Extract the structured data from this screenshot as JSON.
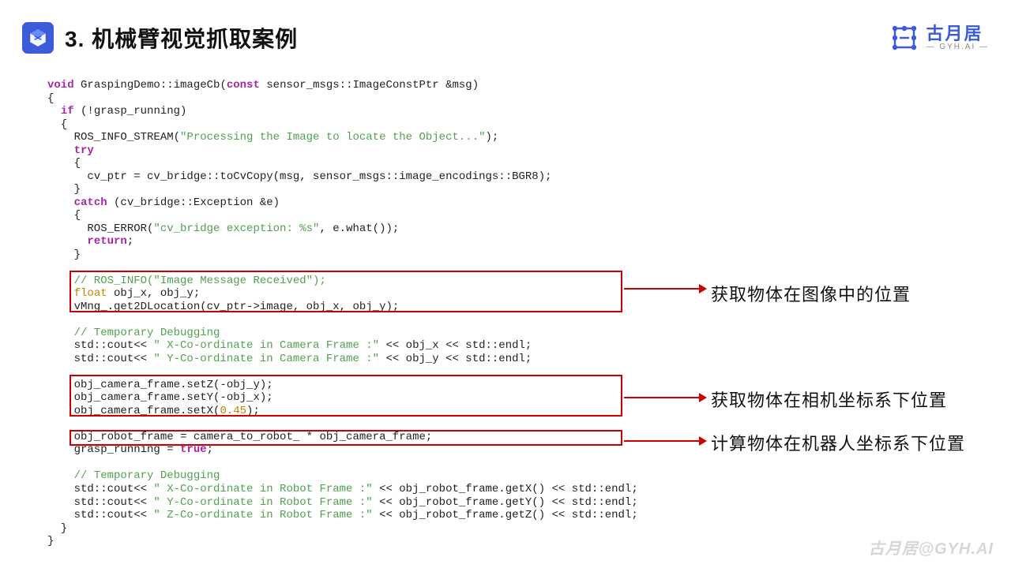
{
  "header": {
    "title": "3. 机械臂视觉抓取案例",
    "brand": {
      "name": "古月居",
      "sub": "— GYH.AI —"
    }
  },
  "code": {
    "fn_sig_pre": "void",
    "fn_sig_name": " GraspingDemo::imageCb(",
    "fn_sig_const": "const",
    "fn_sig_post": " sensor_msgs::ImageConstPtr &msg)",
    "oc1": "{",
    "if_line_pre": "  ",
    "if_kw": "if",
    "if_body": " (!grasp_running)",
    "oc2": "  {",
    "ros_info_pre": "    ROS_INFO_STREAM(",
    "ros_info_str": "\"Processing the Image to locate the Object...\"",
    "ros_info_post": ");",
    "try_pre": "    ",
    "try_kw": "try",
    "oc3": "    {",
    "cvptr": "      cv_ptr = cv_bridge::toCvCopy(msg, sensor_msgs::image_encodings::BGR8);",
    "cc3": "    }",
    "catch_pre": "    ",
    "catch_kw": "catch",
    "catch_body": " (cv_bridge::Exception &e)",
    "oc4": "    {",
    "roserr_pre": "      ROS_ERROR(",
    "roserr_str": "\"cv_bridge exception: %s\"",
    "roserr_post": ", e.what());",
    "return_pre": "      ",
    "return_kw": "return",
    "return_post": ";",
    "cc4": "    }",
    "blank1": "",
    "cmt1": "    // ROS_INFO(\"Image Message Received\");",
    "float_pre": "    ",
    "float_kw": "float",
    "float_post": " obj_x, obj_y;",
    "vmng": "    vMng_.get2DLocation(cv_ptr->image, obj_x, obj_y);",
    "blank2": "",
    "cmt2": "    // Temporary Debugging",
    "cout1_a": "    std::cout<< ",
    "cout1_s": "\" X-Co-ordinate in Camera Frame :\"",
    "cout1_b": " << obj_x << std::endl;",
    "cout2_a": "    std::cout<< ",
    "cout2_s": "\" Y-Co-ordinate in Camera Frame :\"",
    "cout2_b": " << obj_y << std::endl;",
    "blank3": "",
    "setz": "    obj_camera_frame.setZ(-obj_y);",
    "sety": "    obj_camera_frame.setY(-obj_x);",
    "setx_a": "    obj_camera_frame.setX(",
    "setx_n": "0.45",
    "setx_b": ");",
    "blank4": "",
    "robotframe": "    obj_robot_frame = camera_to_robot_ * obj_camera_frame;",
    "grasp_a": "    grasp_running = ",
    "grasp_true": "true",
    "grasp_b": ";",
    "blank5": "",
    "cmt3": "    // Temporary Debugging",
    "cout3_a": "    std::cout<< ",
    "cout3_s": "\" X-Co-ordinate in Robot Frame :\"",
    "cout3_b": " << obj_robot_frame.getX() << std::endl;",
    "cout4_a": "    std::cout<< ",
    "cout4_s": "\" Y-Co-ordinate in Robot Frame :\"",
    "cout4_b": " << obj_robot_frame.getY() << std::endl;",
    "cout5_a": "    std::cout<< ",
    "cout5_s": "\" Z-Co-ordinate in Robot Frame :\"",
    "cout5_b": " << obj_robot_frame.getZ() << std::endl;",
    "cc2": "  }",
    "cc1": "}"
  },
  "annot": {
    "a1": "获取物体在图像中的位置",
    "a2": "获取物体在相机坐标系下位置",
    "a3": "计算物体在机器人坐标系下位置"
  },
  "watermark": "古月居@GYH.AI"
}
